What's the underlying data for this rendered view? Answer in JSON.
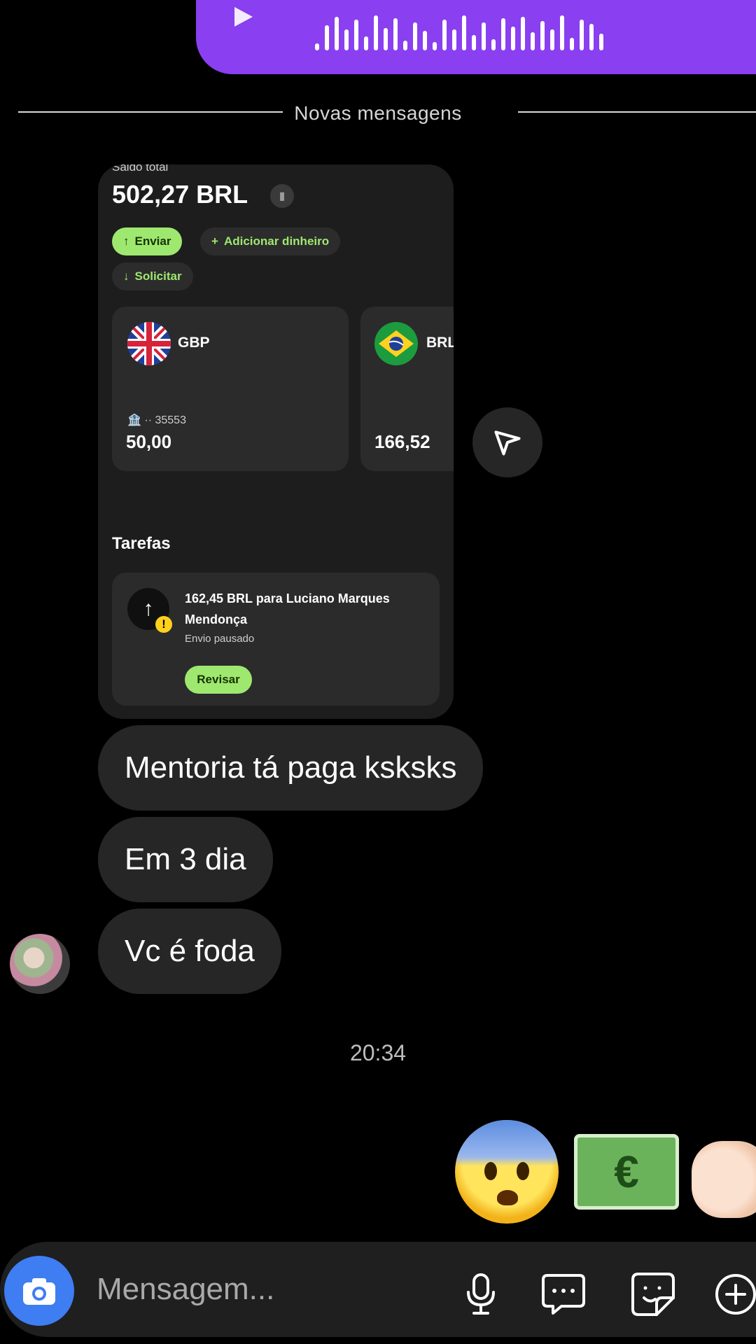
{
  "divider": {
    "label": "Novas mensagens"
  },
  "shared_card": {
    "saldo_label": "Saldo total",
    "balance": "502,27 BRL",
    "buttons": {
      "send": "Enviar",
      "add_money": "Adicionar dinheiro",
      "request": "Solicitar"
    },
    "accounts": [
      {
        "code": "GBP",
        "subline": "·· 35553",
        "amount": "50,00"
      },
      {
        "code": "BRL",
        "amount": "166,52"
      }
    ],
    "tasks_title": "Tarefas",
    "task": {
      "title": "162,45 BRL para Luciano Marques Mendonça",
      "status": "Envio pausado",
      "action": "Revisar"
    }
  },
  "messages": [
    {
      "text": "Mentoria tá paga ksksks"
    },
    {
      "text": "Em 3 dia"
    },
    {
      "text": "Vc é foda"
    }
  ],
  "timestamp": "20:34",
  "composer": {
    "placeholder": "Mensagem..."
  },
  "colors": {
    "accent_purple": "#8a3ff0",
    "wise_green": "#9fe870",
    "camera_blue": "#3f7df2"
  }
}
